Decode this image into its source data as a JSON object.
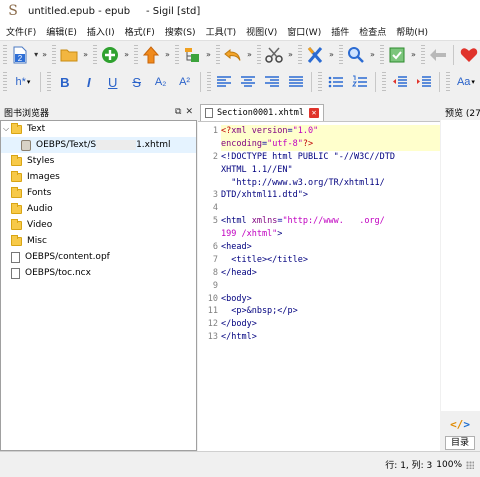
{
  "window": {
    "title": "untitled.epub - epub     - Sigil [std]",
    "app_icon_glyph": "S"
  },
  "menu": [
    "文件(F)",
    "编辑(E)",
    "插入(I)",
    "格式(F)",
    "搜索(S)",
    "工具(T)",
    "视图(V)",
    "窗口(W)",
    "插件",
    "检查点",
    "帮助(H)"
  ],
  "toolbar": {
    "row1_icons": [
      "add-file-icon",
      "open-folder-icon",
      "add-existing-icon",
      "move-up-icon",
      "undo-icon",
      "cut-icon",
      "meta-editor-icon",
      "find-icon",
      "validate-icon",
      "back-icon",
      "donate-heart-icon"
    ],
    "heading_label": "h*",
    "bold_label": "B",
    "italic_label": "I",
    "underline_label": "U",
    "strike_label": "S",
    "subscript_label": "A₂",
    "superscript_label": "A²",
    "case_label": "Aa"
  },
  "book_browser": {
    "title": "图书浏览器",
    "items": [
      {
        "label": "Text",
        "type": "folder",
        "expanded": true
      },
      {
        "label": "OEBPS/Text/S",
        "label_tail": "1.xhtml",
        "type": "html",
        "selected": true
      },
      {
        "label": "Styles",
        "type": "folder"
      },
      {
        "label": "Images",
        "type": "folder"
      },
      {
        "label": "Fonts",
        "type": "folder"
      },
      {
        "label": "Audio",
        "type": "folder"
      },
      {
        "label": "Video",
        "type": "folder"
      },
      {
        "label": "Misc",
        "type": "folder"
      },
      {
        "label": "OEBPS/content.opf",
        "type": "file"
      },
      {
        "label": "OEBPS/toc.ncx",
        "type": "file"
      }
    ]
  },
  "editor": {
    "tab_label": "Section0001.xhtml",
    "line_numbers": [
      "1",
      "",
      "2",
      "",
      "",
      "3",
      "4",
      "5",
      "",
      "6",
      "7",
      "8",
      "9",
      "10",
      "11",
      "12",
      "13"
    ]
  },
  "preview": {
    "title": "预览 (27",
    "toc_tab": "目录",
    "code_view_label": "</>"
  },
  "status": {
    "position": "行: 1, 列: 3",
    "zoom": "100%"
  }
}
